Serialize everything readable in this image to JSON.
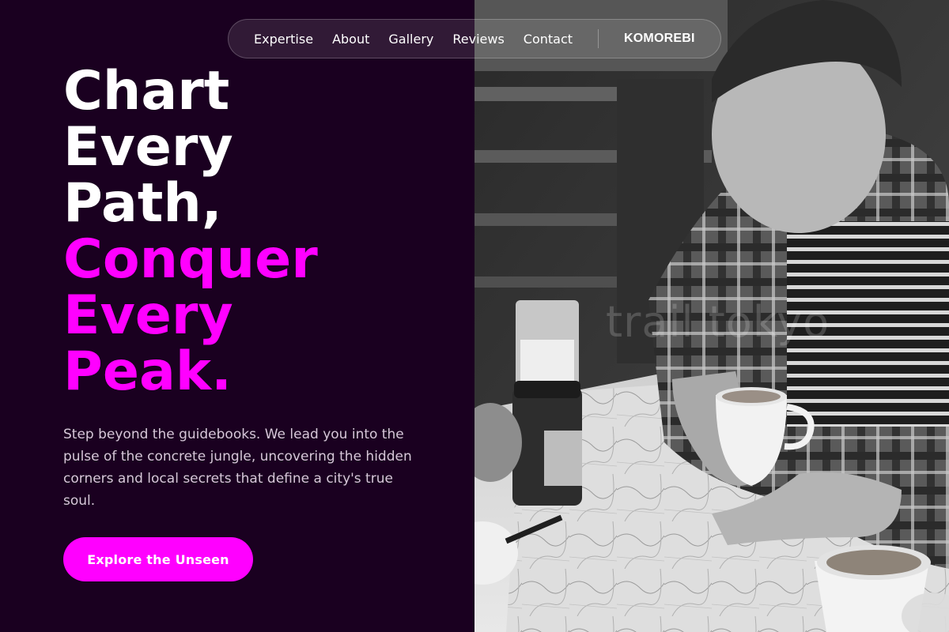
{
  "nav": {
    "links": [
      "Expertise",
      "About",
      "Gallery",
      "Reviews",
      "Contact"
    ],
    "brand": "KOMOREBI"
  },
  "hero": {
    "headline_white": [
      "Chart",
      "Every",
      "Path,"
    ],
    "headline_pink": [
      "Conquer",
      "Every",
      "Peak."
    ],
    "description": "Step beyond the guidebooks. We lead you into the pulse of the concrete jungle, uncovering the hidden corners and local secrets that define a city's true soul.",
    "cta_label": "Explore the Unseen"
  },
  "photo": {
    "watermark": "trail tokyo"
  },
  "colors": {
    "background": "#1a0020",
    "accent": "#ff00ff",
    "text_primary": "#ffffff",
    "text_secondary": "#d6c8d8"
  }
}
